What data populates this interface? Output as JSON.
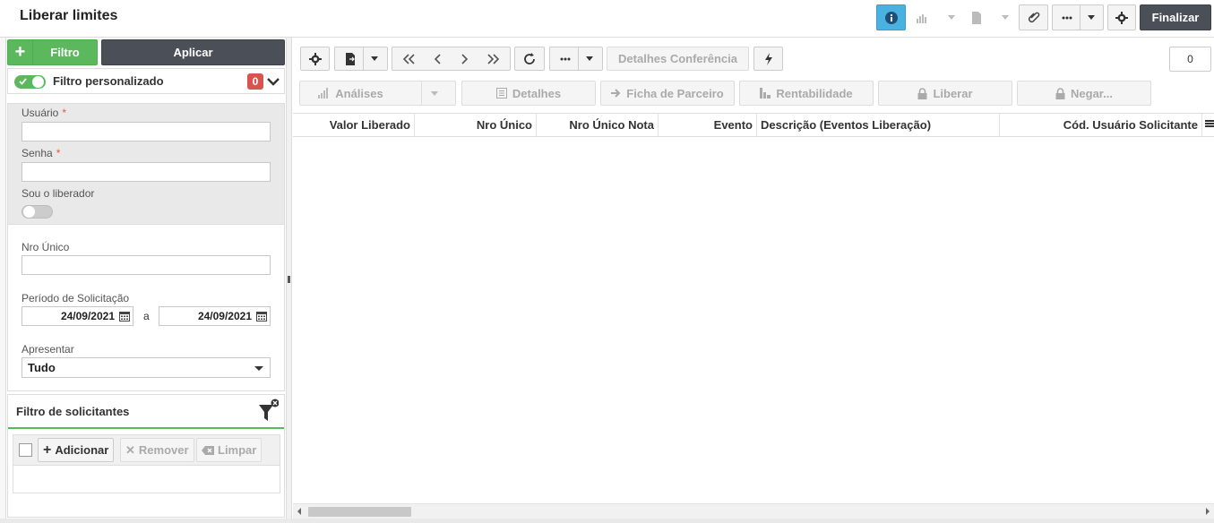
{
  "header": {
    "title": "Liberar limites",
    "finalizar_label": "Finalizar"
  },
  "filter": {
    "filtro_label": "Filtro",
    "aplicar_label": "Aplicar",
    "custom_label": "Filtro personalizado",
    "badge_count": "0",
    "usuario_label": "Usuário",
    "senha_label": "Senha",
    "required_mark": "*",
    "sou_liberador_label": "Sou o liberador",
    "nro_unico_label": "Nro Único",
    "periodo_label": "Período de Solicitação",
    "date_from": "24/09/2021",
    "date_sep": "a",
    "date_to": "24/09/2021",
    "apresentar_label": "Apresentar",
    "apresentar_value": "Tudo"
  },
  "solicitantes": {
    "title": "Filtro de solicitantes",
    "adicionar_label": "Adicionar",
    "remover_label": "Remover",
    "limpar_label": "Limpar"
  },
  "toolbar": {
    "detalhes_conferencia_label": "Detalhes Conferência",
    "record_count": "0"
  },
  "actions": {
    "analises_label": "Análises",
    "detalhes_label": "Detalhes",
    "ficha_parceiro_label": "Ficha de Parceiro",
    "rentabilidade_label": "Rentabilidade",
    "liberar_label": "Liberar",
    "negar_label": "Negar..."
  },
  "grid": {
    "columns": [
      "Valor Liberado",
      "Nro Único",
      "Nro Único Nota",
      "Evento",
      "Descrição (Eventos Liberação)",
      "Cód. Usuário Solicitante"
    ]
  },
  "colors": {
    "green": "#5cb85c",
    "dark": "#4a4f58",
    "info_blue": "#4ab2e0",
    "badge_red": "#d9534f"
  },
  "icons": [
    "info-icon",
    "chart-icon",
    "export-icon",
    "paperclip-icon",
    "more-icon",
    "gear-icon",
    "refresh-icon",
    "lightning-icon",
    "calendar-icon",
    "funnel-icon",
    "menu-icon"
  ]
}
